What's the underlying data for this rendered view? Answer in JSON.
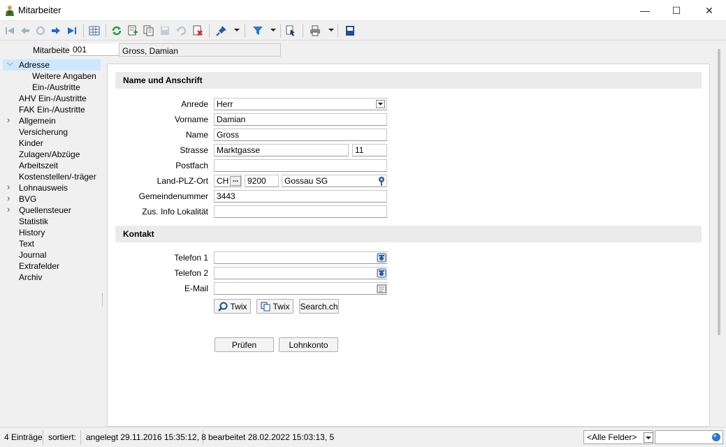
{
  "window": {
    "title": "Mitarbeiter",
    "minimize": "—",
    "maximize": "☐",
    "close": "✕"
  },
  "toolbar": {
    "icons": [
      "first-record-icon",
      "prev-record-icon",
      "refresh-disabled-icon",
      "next-record-icon",
      "last-record-icon",
      "table-view-icon",
      "reload-icon",
      "new-record-icon",
      "copy-record-icon",
      "save-icon",
      "undo-icon",
      "delete-icon",
      "pin-icon",
      "filter-icon",
      "bookmark-icon",
      "print-icon",
      "export-icon"
    ]
  },
  "header": {
    "label": "Mitarbeiter",
    "id": "001",
    "name": "Gross, Damian"
  },
  "tree": {
    "items": [
      {
        "label": "Adresse",
        "level": 0,
        "expanded": true,
        "selected": true
      },
      {
        "label": "Weitere Angaben",
        "level": 1
      },
      {
        "label": "Ein-/Austritte",
        "level": 1
      },
      {
        "label": "AHV Ein-/Austritte",
        "level": 0
      },
      {
        "label": "FAK Ein-/Austritte",
        "level": 0
      },
      {
        "label": "Allgemein",
        "level": 0,
        "collapsed": true
      },
      {
        "label": "Versicherung",
        "level": 0
      },
      {
        "label": "Kinder",
        "level": 0
      },
      {
        "label": "Zulagen/Abzüge",
        "level": 0
      },
      {
        "label": "Arbeitszeit",
        "level": 0
      },
      {
        "label": "Kostenstellen/-träger",
        "level": 0
      },
      {
        "label": "Lohnausweis",
        "level": 0,
        "collapsed": true
      },
      {
        "label": "BVG",
        "level": 0,
        "collapsed": true
      },
      {
        "label": "Quellensteuer",
        "level": 0,
        "collapsed": true
      },
      {
        "label": "Statistik",
        "level": 0
      },
      {
        "label": "History",
        "level": 0
      },
      {
        "label": "Text",
        "level": 0
      },
      {
        "label": "Journal",
        "level": 0
      },
      {
        "label": "Extrafelder",
        "level": 0
      },
      {
        "label": "Archiv",
        "level": 0
      }
    ]
  },
  "form": {
    "section_address": "Name und Anschrift",
    "anrede": {
      "label": "Anrede",
      "value": "Herr"
    },
    "vorname": {
      "label": "Vorname",
      "value": "Damian"
    },
    "name": {
      "label": "Name",
      "value": "Gross"
    },
    "strasse": {
      "label": "Strasse",
      "value": "Marktgasse",
      "number": "11"
    },
    "postfach": {
      "label": "Postfach",
      "value": ""
    },
    "land_plz_ort": {
      "label": "Land-PLZ-Ort",
      "land": "CH",
      "lookup": "...",
      "plz": "9200",
      "ort": "Gossau SG"
    },
    "gemeindenummer": {
      "label": "Gemeindenummer",
      "value": "3443"
    },
    "zus_info": {
      "label": "Zus. Info Lokalität",
      "value": ""
    },
    "section_contact": "Kontakt",
    "telefon1": {
      "label": "Telefon 1",
      "value": ""
    },
    "telefon2": {
      "label": "Telefon 2",
      "value": ""
    },
    "email": {
      "label": "E-Mail",
      "value": ""
    },
    "buttons": {
      "twix_search": "Twix",
      "twix_copy": "Twix",
      "search_ch": "Search.ch",
      "pruefen": "Prüfen",
      "lohnkonto": "Lohnkonto"
    }
  },
  "status": {
    "count": "4 Einträge",
    "sorted": "sortiert:",
    "created": "angelegt 29.11.2016 15:35:12,  8",
    "edited": "bearbeitet 28.02.2022 15:03:13,  5",
    "field_filter": "<Alle Felder>"
  },
  "colors": {
    "selection": "#cce8ff",
    "section": "#ebebeb",
    "accent_blue": "#1e6bd6",
    "accent_green": "#2e9a3a",
    "accent_red": "#d8261c"
  }
}
